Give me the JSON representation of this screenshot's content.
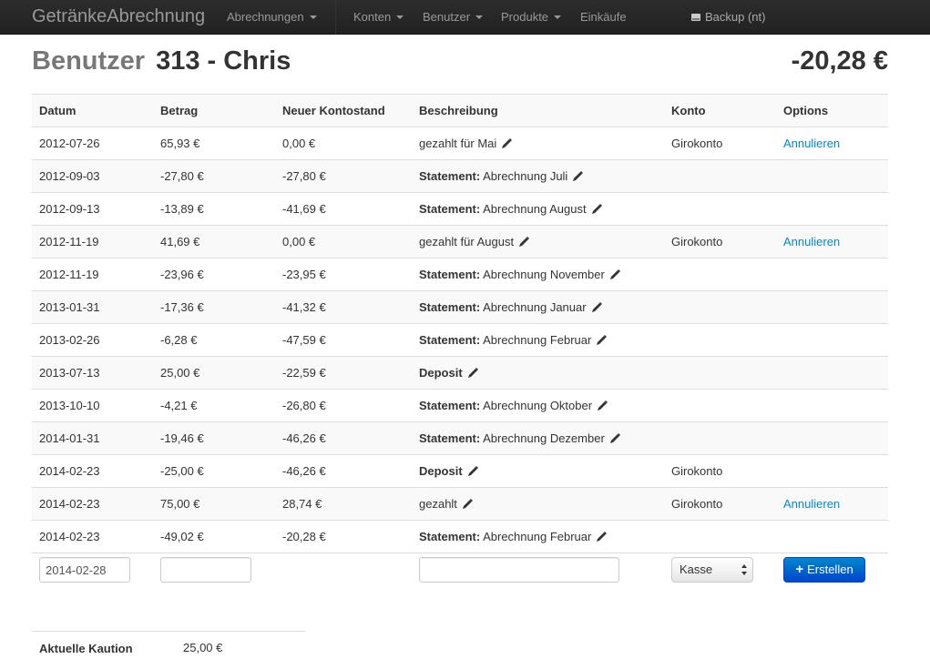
{
  "navbar": {
    "brand": "GetränkeAbrechnung",
    "items": [
      {
        "label": "Abrechnungen",
        "dropdown": true
      },
      {
        "label": "Konten",
        "dropdown": true
      },
      {
        "label": "Benutzer",
        "dropdown": true
      },
      {
        "label": "Produkte",
        "dropdown": true
      },
      {
        "label": "Einkäufe",
        "dropdown": false
      }
    ],
    "backup_label": "Backup (nt)"
  },
  "header": {
    "section": "Benutzer",
    "user": "313 - Chris",
    "balance": "-20,28 €"
  },
  "table": {
    "columns": [
      "Datum",
      "Betrag",
      "Neuer Kontostand",
      "Beschreibung",
      "Konto",
      "Options"
    ],
    "rows": [
      {
        "date": "2012-07-26",
        "amount": "65,93 €",
        "balance": "0,00 €",
        "label": "",
        "desc": "gezahlt für Mai",
        "konto": "Girokonto",
        "option": "Annulieren"
      },
      {
        "date": "2012-09-03",
        "amount": "-27,80 €",
        "balance": "-27,80 €",
        "label": "Statement:",
        "desc": "Abrechnung Juli",
        "konto": "",
        "option": ""
      },
      {
        "date": "2012-09-13",
        "amount": "-13,89 €",
        "balance": "-41,69 €",
        "label": "Statement:",
        "desc": "Abrechnung August",
        "konto": "",
        "option": ""
      },
      {
        "date": "2012-11-19",
        "amount": "41,69 €",
        "balance": "0,00 €",
        "label": "",
        "desc": "gezahlt für August",
        "konto": "Girokonto",
        "option": "Annulieren"
      },
      {
        "date": "2012-11-19",
        "amount": "-23,96 €",
        "balance": "-23,95 €",
        "label": "Statement:",
        "desc": "Abrechnung November",
        "konto": "",
        "option": ""
      },
      {
        "date": "2013-01-31",
        "amount": "-17,36 €",
        "balance": "-41,32 €",
        "label": "Statement:",
        "desc": "Abrechnung Januar",
        "konto": "",
        "option": ""
      },
      {
        "date": "2013-02-26",
        "amount": "-6,28 €",
        "balance": "-47,59 €",
        "label": "Statement:",
        "desc": "Abrechnung Februar",
        "konto": "",
        "option": ""
      },
      {
        "date": "2013-07-13",
        "amount": "25,00 €",
        "balance": "-22,59 €",
        "label": "Deposit",
        "desc": "",
        "konto": "",
        "option": ""
      },
      {
        "date": "2013-10-10",
        "amount": "-4,21 €",
        "balance": "-26,80 €",
        "label": "Statement:",
        "desc": "Abrechnung Oktober",
        "konto": "",
        "option": ""
      },
      {
        "date": "2014-01-31",
        "amount": "-19,46 €",
        "balance": "-46,26 €",
        "label": "Statement:",
        "desc": "Abrechnung Dezember",
        "konto": "",
        "option": ""
      },
      {
        "date": "2014-02-23",
        "amount": "-25,00 €",
        "balance": "-46,26 €",
        "label": "Deposit",
        "desc": "",
        "konto": "Girokonto",
        "option": ""
      },
      {
        "date": "2014-02-23",
        "amount": "75,00 €",
        "balance": "28,74 €",
        "label": "",
        "desc": "gezahlt",
        "konto": "Girokonto",
        "option": "Annulieren"
      },
      {
        "date": "2014-02-23",
        "amount": "-49,02 €",
        "balance": "-20,28 €",
        "label": "Statement:",
        "desc": "Abrechnung Februar",
        "konto": "",
        "option": ""
      }
    ]
  },
  "form": {
    "date_value": "2014-02-28",
    "amount_value": "",
    "desc_value": "",
    "konto_selected": "Kasse",
    "submit_label": "Erstellen"
  },
  "kaution": {
    "label": "Aktuelle Kaution",
    "value": "25,00 €"
  },
  "colors": {
    "navbar": "#222222",
    "link": "#0088cc",
    "button": "#0066cc"
  },
  "icons": [
    "hdd-icon",
    "pencil-icon",
    "plus-icon",
    "select-arrows-icon",
    "chevron-down-icon"
  ]
}
